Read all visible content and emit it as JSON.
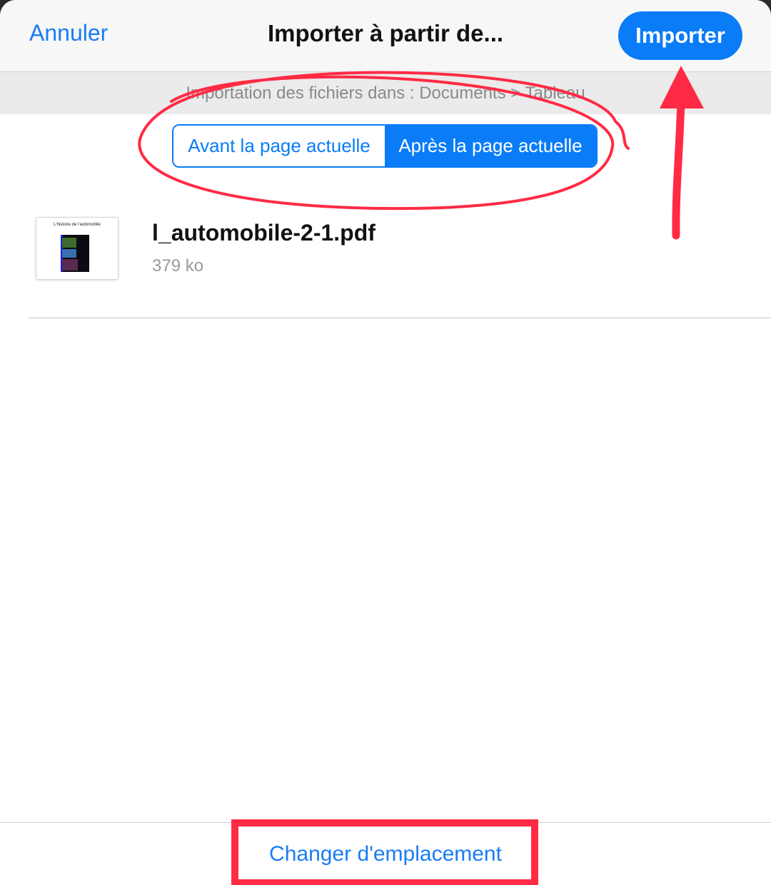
{
  "navbar": {
    "cancel_label": "Annuler",
    "title": "Importer à partir de...",
    "import_label": "Importer"
  },
  "info_bar": {
    "text": "Importation des fichiers dans : Documents > Tableau"
  },
  "position_selector": {
    "options": [
      {
        "label": "Avant la page actuelle",
        "selected": false
      },
      {
        "label": "Après la page actuelle",
        "selected": true
      }
    ]
  },
  "file": {
    "thumbnail_title": "L'histoire de l'automobile",
    "name": "l_automobile-2-1.pdf",
    "size": "379 ko"
  },
  "footer": {
    "change_location_label": "Changer d'emplacement"
  },
  "colors": {
    "accent": "#0a7cf7",
    "annotation": "#ff2b45"
  }
}
